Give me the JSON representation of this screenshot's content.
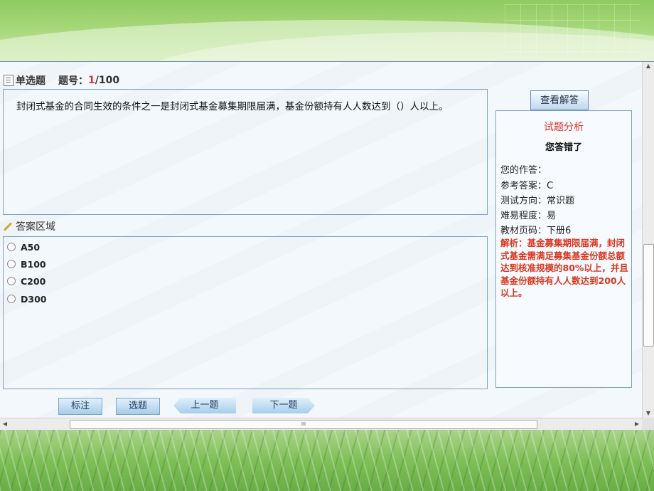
{
  "header": {
    "type_label": "单选题",
    "qnum_label": "题号：",
    "current": "1",
    "total": "/100"
  },
  "question": {
    "text": "封闭式基金的合同生效的条件之一是封闭式基金募集期限届满，基金份额持有人人数达到（）人以上。"
  },
  "answer_area": {
    "title": "答案区域",
    "options": [
      {
        "label": "A50"
      },
      {
        "label": "B100"
      },
      {
        "label": "C200"
      },
      {
        "label": "D300"
      }
    ]
  },
  "analysis": {
    "view_button": "查看解答",
    "title": "试题分析",
    "result": "您答错了",
    "your_answer": "您的作答：",
    "reference": "参考答案：C",
    "direction": "测试方向：常识题",
    "difficulty": "难易程度：易",
    "page": "教材页码：下册6",
    "explanation": "解析：基金募集期限届满，封闭式基金需满足募集基金份额总额达到核准规模的80%以上，并且基金份额持有人人数达到200人以上。"
  },
  "buttons": {
    "mark": "标注",
    "select": "选题",
    "prev": "上一题",
    "next": "下一题"
  },
  "scroll": {
    "h_grip": "III"
  }
}
